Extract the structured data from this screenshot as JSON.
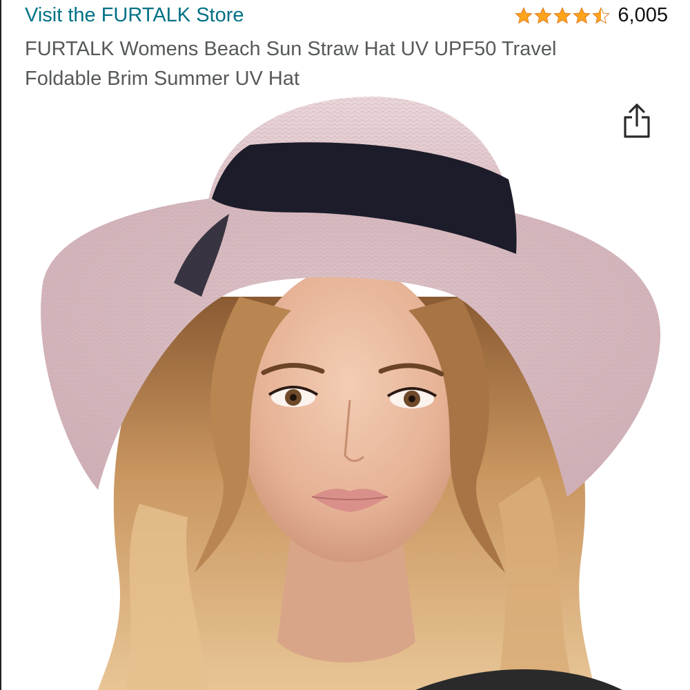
{
  "store": {
    "link_label": "Visit the FURTALK Store",
    "link_color": "#007185"
  },
  "rating": {
    "stars": 4.5,
    "max_stars": 5,
    "count": "6,005",
    "star_color": "#FFA41C"
  },
  "product": {
    "title": "FURTALK Womens Beach Sun Straw Hat UV UPF50 Travel Foldable Brim Summer UV Hat",
    "image": {
      "icon": "product-photo",
      "hat_color": "#e3cbd0",
      "band_color": "#1c1c2a"
    }
  },
  "actions": {
    "share_icon": "share-icon"
  }
}
